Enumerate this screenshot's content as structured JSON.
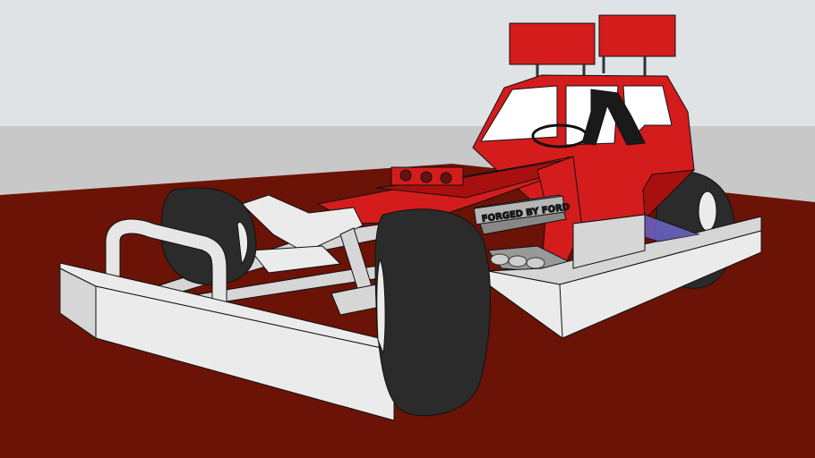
{
  "scene": {
    "kind": "3d-model-render",
    "subject": "stock-car-racing-car",
    "colors": {
      "sky": "#dfe3e6",
      "ground": "#c8c8c8",
      "track": "#6a1306",
      "body_red": "#d41c1c",
      "body_red_dark": "#a81010",
      "chassis_grey": "#d6d6d6",
      "chassis_light": "#ebebeb",
      "tire": "#2b2b2b",
      "tire_dark": "#1a1a1a",
      "panel_blue": "#6b64c9",
      "outline": "#111111"
    },
    "engine_label": "FORGED BY FORD"
  }
}
